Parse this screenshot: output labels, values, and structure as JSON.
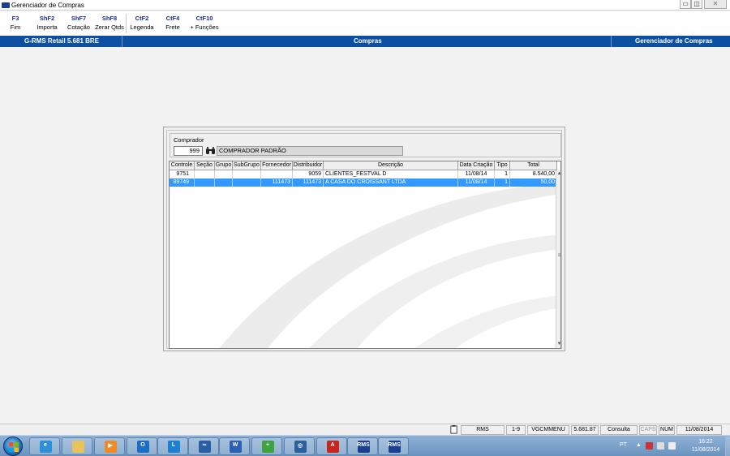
{
  "window": {
    "title": "Gerenciador de Compras",
    "min": "▭",
    "max": "◫",
    "close": "✕"
  },
  "toolbar": [
    {
      "key": "F3",
      "label": "Fim"
    },
    {
      "key": "ShF2",
      "label": "Importa"
    },
    {
      "key": "ShF7",
      "label": "Cotação"
    },
    {
      "key": "ShF8",
      "label": "Zerar Qtds"
    },
    {
      "key": "CtF2",
      "label": "Legenda"
    },
    {
      "key": "CtF4",
      "label": "Frete"
    },
    {
      "key": "CtF10",
      "label": "+ Funções"
    }
  ],
  "header": {
    "left": "G-RMS Retail 5.681 BRE",
    "center": "Compras",
    "right": "Gerenciador de Compras"
  },
  "buyer": {
    "label": "Comprador",
    "code": "999",
    "name": "COMPRADOR PADRÃO"
  },
  "grid": {
    "columns": [
      "Controle",
      "Seção",
      "Grupo",
      "SubGrupo",
      "Fornecedor",
      "Distribuidor",
      "Descrição",
      "Data Criação",
      "Tipo",
      "Total"
    ],
    "rows": [
      {
        "controle": "9751",
        "secao": "",
        "grupo": "",
        "subgrupo": "",
        "fornecedor": "",
        "distribuidor": "9059",
        "descricao": "CLIENTES_FESTVAL D",
        "data": "11/08/14",
        "tipo": "1",
        "total": "8.540,00",
        "selected": false
      },
      {
        "controle": "89749",
        "secao": "",
        "grupo": "",
        "subgrupo": "",
        "fornecedor": "111473",
        "distribuidor": "111473",
        "descricao": "A CASA DO CROISSANT LTDA",
        "data": "11/08/14",
        "tipo": "1",
        "total": "50,00",
        "selected": true
      }
    ]
  },
  "statusbar": {
    "app": "RMS",
    "range": "1-9",
    "menu": "VGCMMENU",
    "version": "5.681.87",
    "mode": "Consulta",
    "caps": "CAPS",
    "num": "NUM",
    "date": "11/08/2014"
  },
  "taskbar": {
    "apps": [
      {
        "name": "internet-explorer",
        "color": "#2d8fd8",
        "text": "e"
      },
      {
        "name": "file-explorer",
        "color": "#e8c25a",
        "text": ""
      },
      {
        "name": "media-player",
        "color": "#f08a24",
        "text": "▶"
      },
      {
        "name": "outlook",
        "color": "#1b6ec2",
        "text": "O"
      },
      {
        "name": "lync",
        "color": "#1d7fd0",
        "text": "L"
      },
      {
        "name": "infinity-app",
        "color": "#2a5fa6",
        "text": "∞"
      },
      {
        "name": "word",
        "color": "#2b5fb4",
        "text": "W"
      },
      {
        "name": "hardware-tool",
        "color": "#3fa340",
        "text": "+"
      },
      {
        "name": "network-tool",
        "color": "#2c5f9e",
        "text": "◎"
      },
      {
        "name": "acrobat",
        "color": "#c8261d",
        "text": "A"
      },
      {
        "name": "rms-1",
        "color": "#1a3f8f",
        "text": "RMS"
      },
      {
        "name": "rms-2",
        "color": "#1a3f8f",
        "text": "RMS"
      }
    ],
    "lang": "PT",
    "time": "16:22",
    "date": "11/08/2014"
  }
}
